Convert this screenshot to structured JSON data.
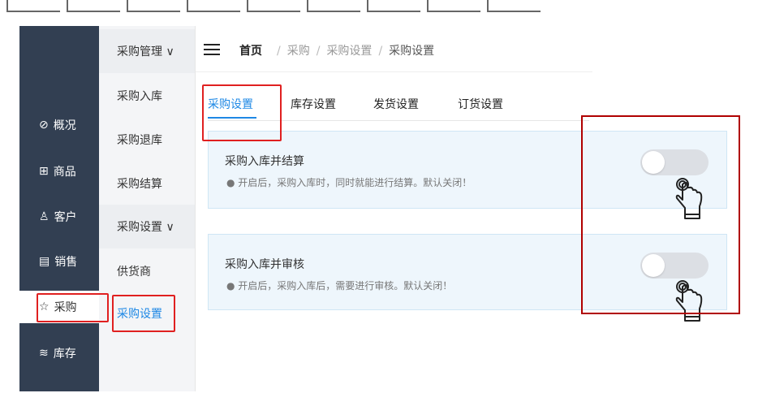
{
  "sidebar": {
    "items": [
      {
        "icon": "compass-icon",
        "glyph": "⊘",
        "label": "概况"
      },
      {
        "icon": "grid-icon",
        "glyph": "⊞",
        "label": "商品"
      },
      {
        "icon": "user-icon",
        "glyph": "♙",
        "label": "客户"
      },
      {
        "icon": "document-icon",
        "glyph": "▤",
        "label": "销售"
      },
      {
        "icon": "star-icon",
        "glyph": "☆",
        "label": "采购"
      },
      {
        "icon": "layers-icon",
        "glyph": "≋",
        "label": "库存"
      }
    ]
  },
  "subnav": {
    "group1": "采购管理 ∨",
    "group1_items": [
      "采购入库",
      "采购退库",
      "采购结算"
    ],
    "group2": "采购设置 ∨",
    "group2_items": [
      "供货商",
      "采购设置"
    ]
  },
  "breadcrumb": {
    "home": "首页",
    "sep": "/",
    "level1": "采购",
    "level2": "采购设置",
    "current": "采购设置"
  },
  "tabs": [
    "采购设置",
    "库存设置",
    "发货设置",
    "订货设置"
  ],
  "settings": [
    {
      "title": "采购入库并结算",
      "desc": "● 开启后，采购入库时，同时就能进行结算。默认关闭！",
      "enabled": false
    },
    {
      "title": "采购入库并审核",
      "desc": "● 开启后，采购入库后，需要进行审核。默认关闭！",
      "enabled": false
    }
  ],
  "colors": {
    "accent": "#1e88e5",
    "sidebar_bg": "#323f52",
    "highlight": "#e02020"
  }
}
